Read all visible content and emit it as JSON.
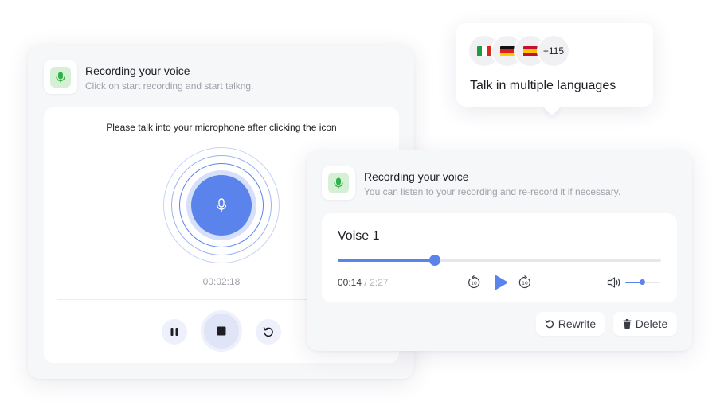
{
  "recording_card": {
    "title": "Recording your voice",
    "subtitle": "Click on start recording and start talkng.",
    "instruction": "Please talk into your microphone after clicking the icon",
    "timer": "00:02:18",
    "icons": {
      "app": "microphone-icon",
      "record": "microphone-icon",
      "pause": "pause-icon",
      "stop": "stop-icon",
      "reset": "reset-icon"
    }
  },
  "languages": {
    "flags": [
      "italy-flag",
      "germany-flag",
      "spain-flag"
    ],
    "more_count": "+115",
    "label": "Talk in multiple languages"
  },
  "playback_card": {
    "title": "Recording your voice",
    "subtitle": "You can listen to your recording and re-record it if necessary.",
    "recording_name": "Voise 1",
    "current_time": "00:14",
    "separator": "/",
    "total_time": "2:27",
    "progress": 0.3,
    "volume": 0.48,
    "rewrite_label": "Rewrite",
    "delete_label": "Delete",
    "icons": {
      "app": "microphone-icon",
      "rewind": "rewind-10-icon",
      "play": "play-icon",
      "forward": "forward-10-icon",
      "volume": "volume-icon",
      "rewrite": "reset-icon",
      "delete": "trash-icon"
    }
  },
  "colors": {
    "accent": "#5b83ec",
    "icon_tint": "#d6f0d5",
    "icon_green": "#2fb14a",
    "card_bg": "#f6f7f9"
  }
}
